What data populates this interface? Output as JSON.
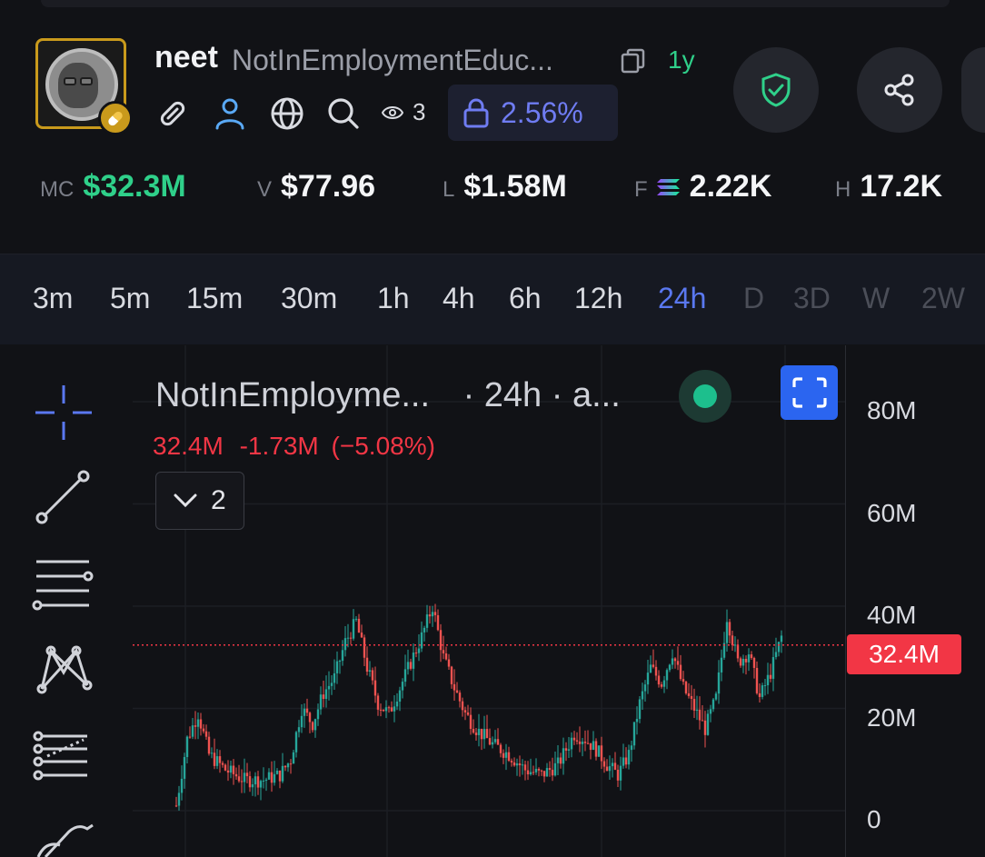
{
  "token": {
    "ticker": "neet",
    "name": "NotInEmploymentEduc...",
    "age": "1y",
    "views": "3",
    "lock_percent": "2.56%"
  },
  "stats": [
    {
      "key": "MC",
      "value": "$32.3M",
      "color": "#2fd08a"
    },
    {
      "key": "V",
      "value": "$77.96"
    },
    {
      "key": "L",
      "value": "$1.58M"
    },
    {
      "key": "F",
      "value": "2.22K"
    },
    {
      "key": "H",
      "value": "17.2K"
    }
  ],
  "timeframes": [
    "3m",
    "5m",
    "15m",
    "30m",
    "1h",
    "4h",
    "6h",
    "12h",
    "24h",
    "D",
    "3D",
    "W",
    "2W"
  ],
  "active_timeframe": "24h",
  "chart": {
    "legend_title": "NotInEmployme...",
    "legend_interval": "· 24h · a...",
    "last_value": "32.4M",
    "change": "-1.73M",
    "change_pct": "(−5.08%)",
    "indicator_count": "2",
    "price_tag": "32.4M"
  },
  "chart_data": {
    "type": "candlestick",
    "title": "",
    "y_ticks": [
      "80M",
      "60M",
      "40M",
      "20M",
      "0"
    ],
    "y_tick_values": [
      80000000,
      60000000,
      40000000,
      20000000,
      0
    ],
    "ylim": [
      0,
      85000000
    ],
    "current_price": 32400000,
    "up_color": "#26a69a",
    "down_color": "#ef5350",
    "envelope": [
      [
        0,
        1
      ],
      [
        4,
        14
      ],
      [
        8,
        19
      ],
      [
        12,
        11
      ],
      [
        18,
        8
      ],
      [
        25,
        6
      ],
      [
        32,
        6
      ],
      [
        38,
        7
      ],
      [
        42,
        10
      ],
      [
        46,
        20
      ],
      [
        50,
        17
      ],
      [
        54,
        23
      ],
      [
        58,
        26
      ],
      [
        62,
        33
      ],
      [
        66,
        37
      ],
      [
        70,
        28
      ],
      [
        74,
        21
      ],
      [
        78,
        19
      ],
      [
        82,
        24
      ],
      [
        86,
        29
      ],
      [
        90,
        34
      ],
      [
        94,
        40
      ],
      [
        98,
        30
      ],
      [
        102,
        24
      ],
      [
        106,
        19
      ],
      [
        110,
        16
      ],
      [
        116,
        13
      ],
      [
        122,
        11
      ],
      [
        128,
        8
      ],
      [
        134,
        7
      ],
      [
        140,
        9
      ],
      [
        146,
        15
      ],
      [
        150,
        14
      ],
      [
        154,
        12
      ],
      [
        158,
        9
      ],
      [
        162,
        7
      ],
      [
        166,
        11
      ],
      [
        170,
        21
      ],
      [
        174,
        28
      ],
      [
        178,
        25
      ],
      [
        182,
        31
      ],
      [
        186,
        24
      ],
      [
        190,
        20
      ],
      [
        194,
        16
      ],
      [
        198,
        22
      ],
      [
        202,
        38
      ],
      [
        206,
        29
      ],
      [
        210,
        31
      ],
      [
        214,
        22
      ],
      [
        218,
        27
      ],
      [
        222,
        34
      ]
    ],
    "envelope_note_hidden": true
  },
  "colors": {
    "background": "#111216",
    "accent_blue": "#5a78f0",
    "green": "#2fd08a",
    "red": "#f23645",
    "gold": "#c99a1c"
  },
  "icons": [
    "link-icon",
    "user-icon",
    "globe-icon",
    "search-icon",
    "eye-icon",
    "lock-icon",
    "shield-check-icon",
    "share-icon",
    "copy-icon",
    "crosshair-icon",
    "trend-line-icon",
    "horizontal-lines-icon",
    "pattern-icon",
    "fib-icon",
    "brush-icon"
  ]
}
